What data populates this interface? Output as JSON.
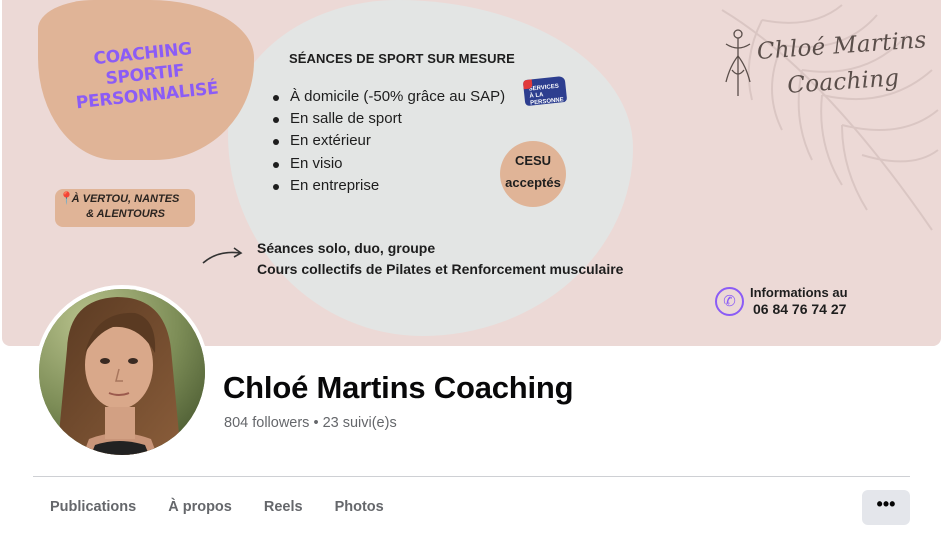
{
  "cover": {
    "badge_title_line1": "COACHING SPORTIF",
    "badge_title_line2": "PERSONNALISÉ",
    "location_line1": "À VERTOU, NANTES",
    "location_line2": "& ALENTOURS",
    "section_title": "SÉANCES DE SPORT SUR MESURE",
    "bullets": [
      "À domicile (-50% grâce au SAP)",
      "En salle de sport",
      "En extérieur",
      "En visio",
      "En entreprise"
    ],
    "sap_badge_text": "SERVICES À LA PERSONNE",
    "cesu_line1": "CESU",
    "cesu_line2": "acceptés",
    "extra_line1": "Séances solo, duo, groupe",
    "extra_line2": "Cours collectifs de Pilates et Renforcement musculaire",
    "logo_line1": "Chloé Martins",
    "logo_line2": "Coaching",
    "info_label": "Informations au",
    "info_phone": "06 84 76 74 27",
    "colors": {
      "background": "#ecd9d6",
      "tan": "#e0b497",
      "purple": "#8b5cf6"
    }
  },
  "profile": {
    "name": "Chloé Martins Coaching",
    "stats": "804 followers • 23 suivi(e)s"
  },
  "tabs": [
    {
      "label": "Publications"
    },
    {
      "label": "À propos"
    },
    {
      "label": "Reels"
    },
    {
      "label": "Photos"
    }
  ],
  "more_button": {
    "label": "•••",
    "icon": "more-horizontal-icon"
  }
}
